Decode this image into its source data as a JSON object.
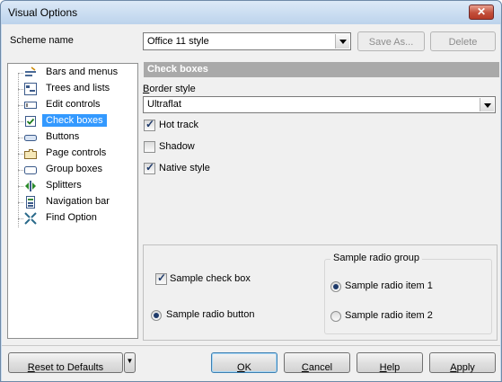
{
  "window": {
    "title": "Visual Options",
    "close_glyph": "✕"
  },
  "scheme": {
    "label": "Scheme name",
    "value": "Office 11 style",
    "save_as": "Save As...",
    "delete": "Delete"
  },
  "tree": {
    "items": [
      {
        "label": "Bars and menus",
        "icon": "bars-menus-icon"
      },
      {
        "label": "Trees and lists",
        "icon": "tree-list-icon"
      },
      {
        "label": "Edit controls",
        "icon": "edit-control-icon"
      },
      {
        "label": "Check boxes",
        "icon": "checkbox-icon",
        "selected": true
      },
      {
        "label": "Buttons",
        "icon": "button-icon"
      },
      {
        "label": "Page controls",
        "icon": "page-control-icon"
      },
      {
        "label": "Group boxes",
        "icon": "group-box-icon"
      },
      {
        "label": "Splitters",
        "icon": "splitter-icon"
      },
      {
        "label": "Navigation bar",
        "icon": "navigation-bar-icon"
      },
      {
        "label": "Find Option",
        "icon": "find-option-icon"
      }
    ]
  },
  "panel": {
    "section_title": "Check boxes",
    "border_style_label": "Border style",
    "border_style_value": "Ultraflat",
    "hot_track": {
      "label": "Hot track",
      "checked": true
    },
    "shadow": {
      "label": "Shadow",
      "checked": false
    },
    "native_style": {
      "label": "Native style",
      "checked": true
    }
  },
  "sample": {
    "check_box": {
      "label": "Sample check box",
      "checked": true
    },
    "radio_button": {
      "label": "Sample radio button",
      "checked": true
    },
    "group_title": "Sample radio group",
    "radio_item_1": {
      "label": "Sample radio item 1",
      "checked": true
    },
    "radio_item_2": {
      "label": "Sample radio item 2",
      "checked": false
    }
  },
  "buttons": {
    "reset": "Reset to Defaults",
    "ok": "OK",
    "cancel": "Cancel",
    "help": "Help",
    "apply": "Apply"
  }
}
